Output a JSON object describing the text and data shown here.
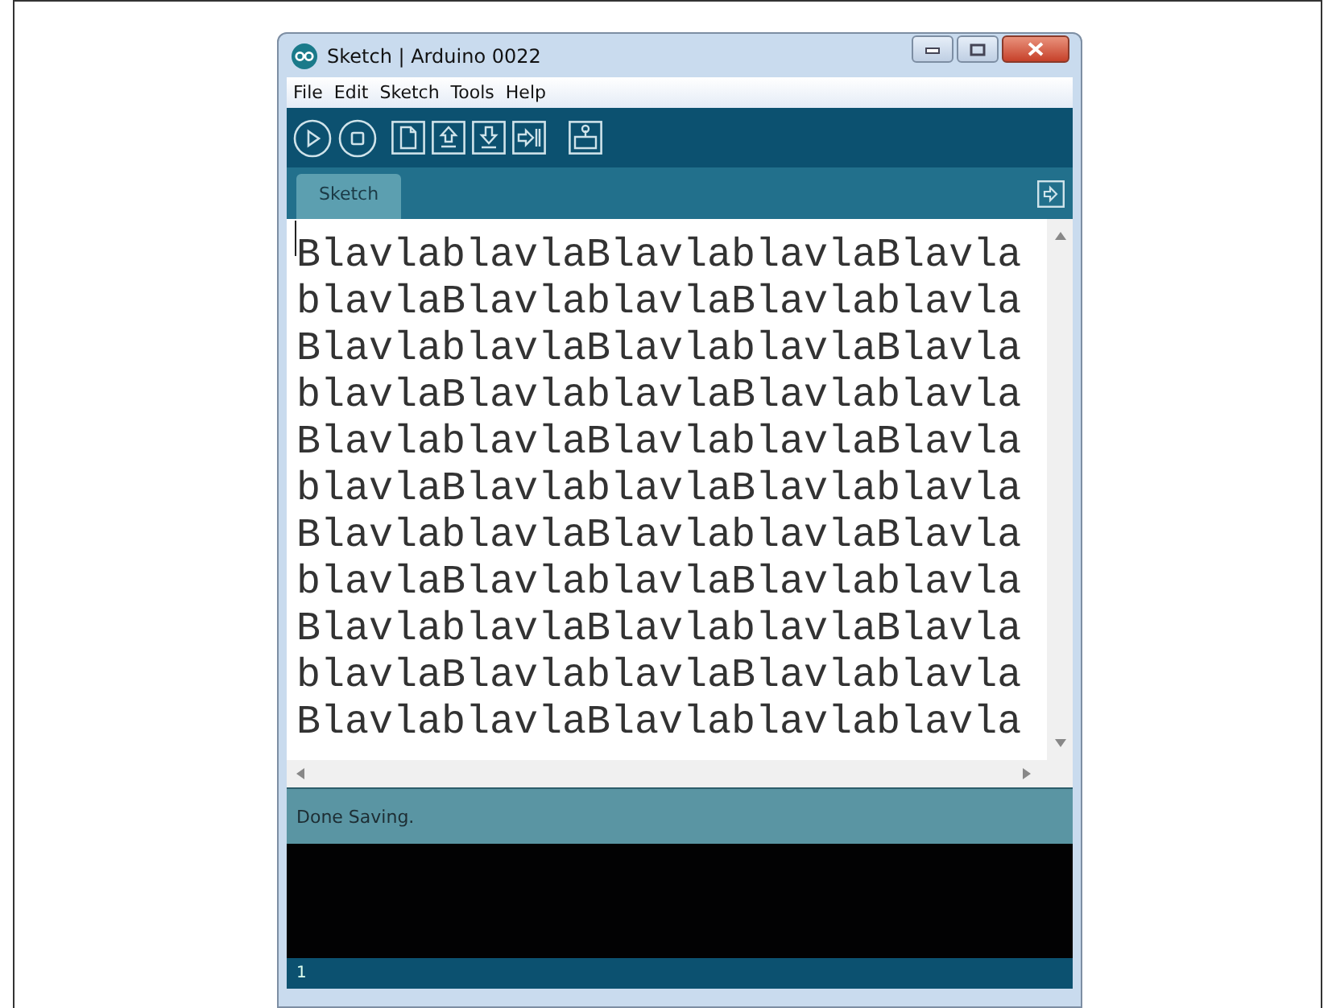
{
  "window": {
    "title": "Sketch | Arduino 0022"
  },
  "menu": [
    {
      "label": "File"
    },
    {
      "label": "Edit"
    },
    {
      "label": "Sketch"
    },
    {
      "label": "Tools"
    },
    {
      "label": "Help"
    }
  ],
  "toolbar": [
    {
      "kind": "run"
    },
    {
      "kind": "stop"
    },
    {
      "kind": "new"
    },
    {
      "kind": "open"
    },
    {
      "kind": "save"
    },
    {
      "kind": "upload"
    },
    {
      "kind": "monitor"
    }
  ],
  "tabs": [
    {
      "label": "Sketch",
      "selected": true
    }
  ],
  "editor": {
    "lines": [
      "BlavlablavlaBlavlablavlaBlavla",
      "blavlaBlavlablavlaBlavlablavla",
      "BlavlablavlaBlavlablavlaBlavla",
      "blavlaBlavlablavlaBlavlablavla",
      "BlavlablavlaBlavlablavlaBlavla",
      "blavlaBlavlablavlaBlavlablavla",
      "BlavlablavlaBlavlablavlaBlavla",
      "blavlaBlavlablavlaBlavlablavla",
      "BlavlablavlaBlavlablavlaBlavla",
      "blavlaBlavlablavlaBlavlablavla",
      "BlavlablavlaBlavlablavlablavla"
    ]
  },
  "status": {
    "message": "Done Saving."
  },
  "footer": {
    "line_number": "1"
  }
}
